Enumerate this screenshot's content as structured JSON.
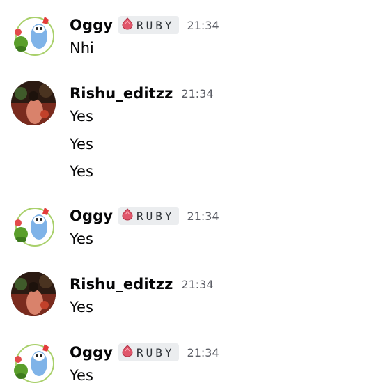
{
  "messages": [
    {
      "author": "Oggy",
      "role": "RUBY",
      "time": "21:34",
      "lines": [
        "Nhi"
      ]
    },
    {
      "author": "Rishu_editzz",
      "time": "21:34",
      "lines": [
        "Yes",
        "Yes",
        "Yes"
      ]
    },
    {
      "author": "Oggy",
      "role": "RUBY",
      "time": "21:34",
      "lines": [
        "Yes"
      ]
    },
    {
      "author": "Rishu_editzz",
      "time": "21:34",
      "lines": [
        "Yes"
      ]
    },
    {
      "author": "Oggy",
      "role": "RUBY",
      "time": "21:34",
      "lines": [
        "Yes"
      ]
    }
  ],
  "icons": {
    "ruby_role": "ruby-gem-icon"
  },
  "colors": {
    "ruby": "#e0566a",
    "role_bg": "#ebedef",
    "timestamp": "#5c5e66"
  }
}
